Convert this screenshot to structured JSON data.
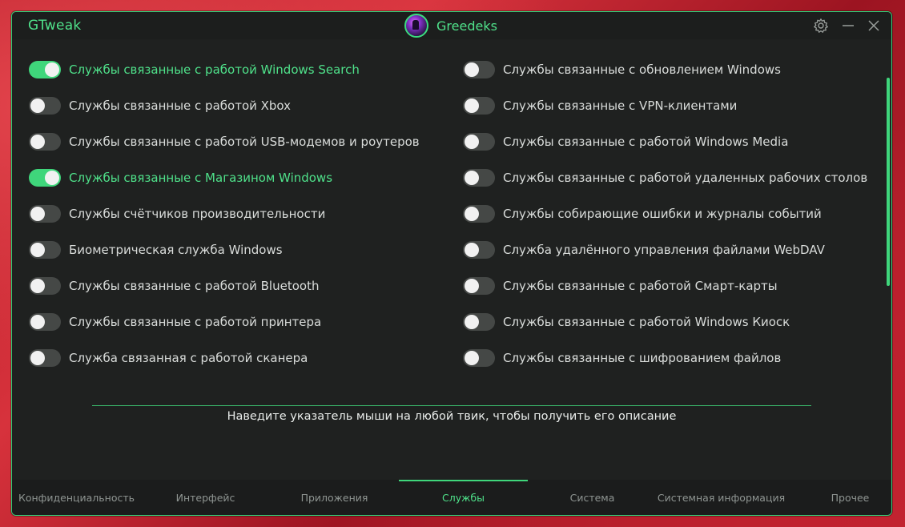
{
  "app": {
    "title": "GTweak",
    "user_name": "Greedeks"
  },
  "colors": {
    "accent": "#3fd67b",
    "window_bg": "#1f2120",
    "text": "#d9dcda",
    "toggle_off": "#454846"
  },
  "titlebar_icons": [
    "gear-icon",
    "minimize-icon",
    "close-icon"
  ],
  "services": {
    "left": [
      {
        "label": "Службы связанные с работой Windows Search",
        "on": true
      },
      {
        "label": "Службы связанные с работой Xbox",
        "on": false
      },
      {
        "label": "Службы связанные с работой USB-модемов и роутеров",
        "on": false
      },
      {
        "label": "Службы связанные с Магазином Windows",
        "on": true
      },
      {
        "label": "Службы счётчиков производительности",
        "on": false
      },
      {
        "label": "Биометрическая служба Windows",
        "on": false
      },
      {
        "label": "Службы связанные с работой Bluetooth",
        "on": false
      },
      {
        "label": "Службы связанные с работой принтера",
        "on": false
      },
      {
        "label": "Служба связанная с работой сканера",
        "on": false
      }
    ],
    "right": [
      {
        "label": "Службы связанные с обновлением Windows",
        "on": false
      },
      {
        "label": "Службы связанные с VPN-клиентами",
        "on": false
      },
      {
        "label": "Службы связанные с работой Windows Media",
        "on": false
      },
      {
        "label": "Службы связанные с работой удаленных рабочих столов",
        "on": false
      },
      {
        "label": "Службы собирающие ошибки и журналы событий",
        "on": false
      },
      {
        "label": "Служба удалённого управления файлами WebDAV",
        "on": false
      },
      {
        "label": "Службы связанные с работой Смарт-карты",
        "on": false
      },
      {
        "label": "Службы связанные с работой Windows Киоск",
        "on": false
      },
      {
        "label": "Службы связанные с шифрованием файлов",
        "on": false
      }
    ]
  },
  "hint": "Наведите указатель мыши на любой твик, чтобы получить его описание",
  "tabs": [
    {
      "label": "Конфиденциальность",
      "active": false
    },
    {
      "label": "Интерфейс",
      "active": false
    },
    {
      "label": "Приложения",
      "active": false
    },
    {
      "label": "Службы",
      "active": true
    },
    {
      "label": "Система",
      "active": false
    },
    {
      "label": "Системная информация",
      "active": false
    },
    {
      "label": "Прочее",
      "active": false
    }
  ]
}
